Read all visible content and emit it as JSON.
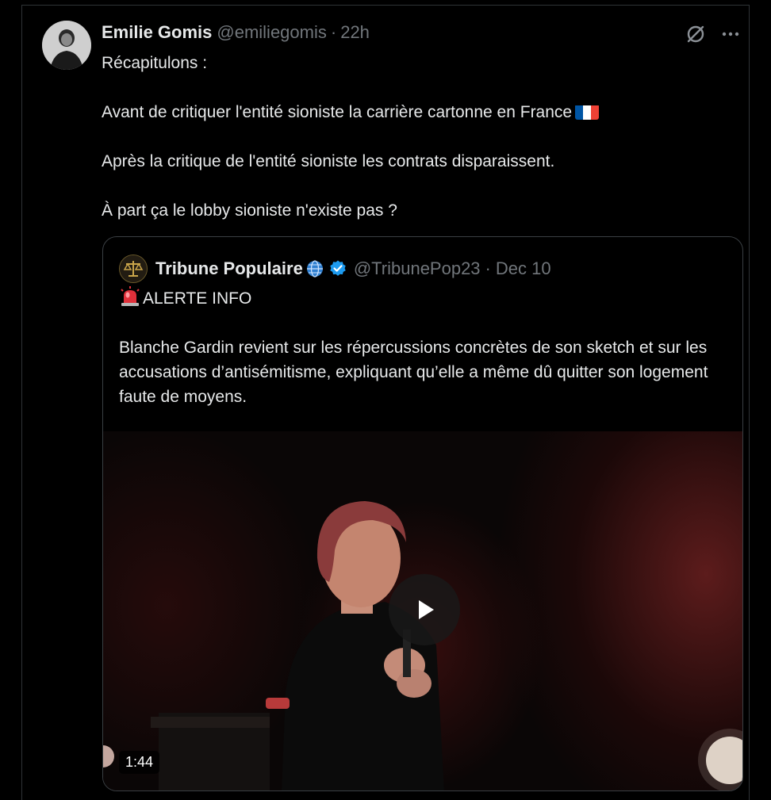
{
  "tweet": {
    "author_name": "Emilie Gomis",
    "author_handle": "@emiliegomis",
    "separator": "·",
    "time": "22h",
    "lines": [
      "Récapitulons :",
      "Avant de critiquer l'entité sioniste la carrière cartonne en France",
      "Après la critique de l'entité sioniste les contrats disparaissent.",
      "À part ça le lobby sioniste n'existe pas ?"
    ],
    "flag_colors": [
      "#0055a4",
      "#ffffff",
      "#ef4135"
    ]
  },
  "quote": {
    "author_name": "Tribune Populaire",
    "author_handle": "@TribunePop23",
    "separator": "·",
    "time": "Dec 10",
    "alert": "ALERTE INFO",
    "body": "Blanche Gardin revient sur les répercussions concrètes de son sketch et sur les accusations d’antisémitisme, expliquant qu’elle a même dû quitter son logement faute de moyens.",
    "video_duration": "1:44"
  },
  "icons": {
    "grok": "slashed-circle-icon",
    "more": "more-dots-icon",
    "globe": "globe-icon",
    "verified": "verified-badge-icon",
    "siren": "siren-icon",
    "play": "play-icon"
  },
  "colors": {
    "background": "#000000",
    "text": "#e7e9ea",
    "muted": "#71767b",
    "verified": "#1d9bf0",
    "border": "#2f3336"
  }
}
